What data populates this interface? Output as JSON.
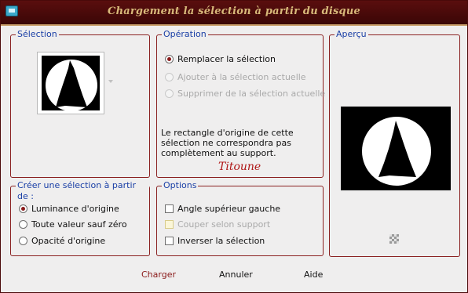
{
  "window": {
    "title": "Chargement la sélection à partir du disque"
  },
  "selection_group": {
    "legend": "Sélection"
  },
  "operation_group": {
    "legend": "Opération",
    "options": [
      {
        "label": "Remplacer la sélection",
        "selected": true,
        "enabled": true
      },
      {
        "label": "Ajouter à la sélection actuelle",
        "selected": false,
        "enabled": false
      },
      {
        "label": "Supprimer de la sélection actuelle",
        "selected": false,
        "enabled": false
      }
    ],
    "note_lines": [
      "Le rectangle d'origine de cette",
      "sélection ne correspondra pas",
      "complètement au support."
    ],
    "signature": "Titoune"
  },
  "preview_group": {
    "legend": "Aperçu"
  },
  "create_group": {
    "legend": "Créer une sélection à partir de :",
    "options": [
      {
        "label": "Luminance d'origine",
        "selected": true
      },
      {
        "label": "Toute valeur sauf zéro",
        "selected": false
      },
      {
        "label": "Opacité d'origine",
        "selected": false
      }
    ]
  },
  "options_group": {
    "legend": "Options",
    "checkboxes": [
      {
        "label": "Angle supérieur gauche",
        "checked": false,
        "enabled": true
      },
      {
        "label": "Couper selon support",
        "checked": false,
        "enabled": false
      },
      {
        "label": "Inverser la sélection",
        "checked": false,
        "enabled": true
      }
    ]
  },
  "buttons": {
    "load": "Charger",
    "cancel": "Annuler",
    "help": "Aide"
  },
  "colors": {
    "titlebar": "#4a0a0a",
    "title_text": "#d8b97a",
    "group_border": "#8a2020",
    "legend_text": "#1a3fa6",
    "accent": "#8a1a1a"
  }
}
